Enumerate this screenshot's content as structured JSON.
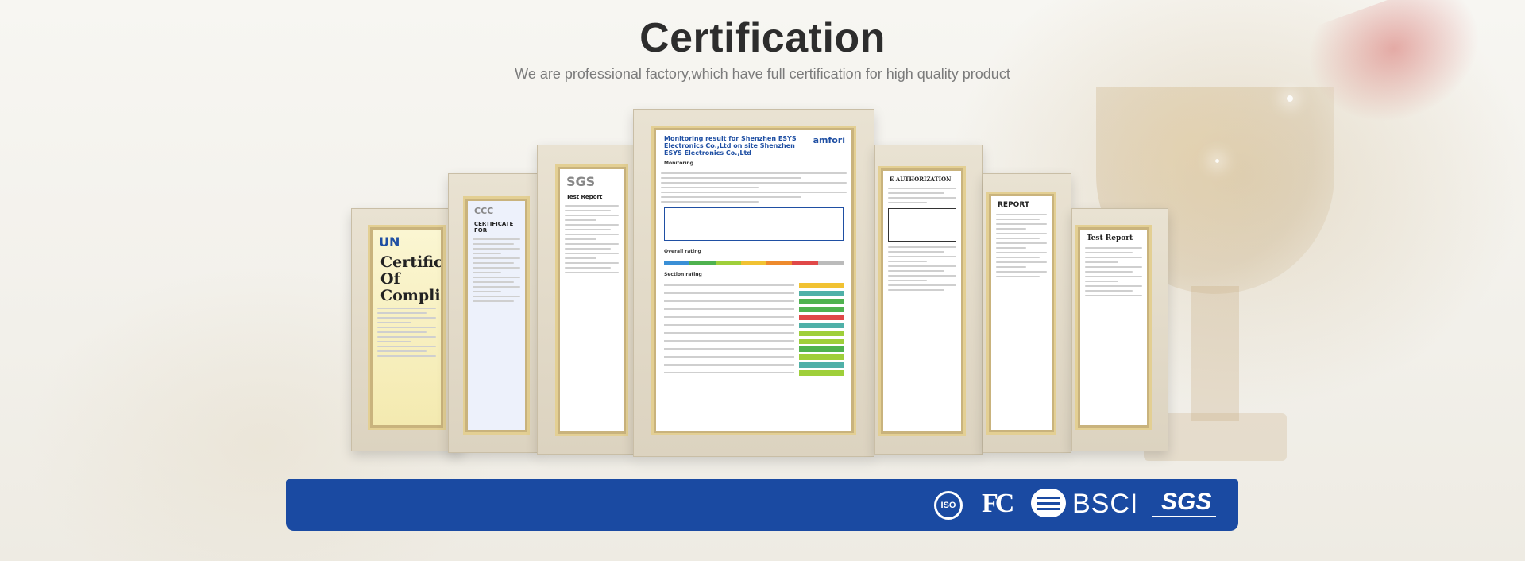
{
  "header": {
    "title": "Certification",
    "subtitle": "We are professional factory,which have full certification for high quality product"
  },
  "certificates": [
    {
      "name": "UN compliance certificate",
      "heading": "Certificate Of Compliance",
      "logo": "UN"
    },
    {
      "name": "CCC certificate",
      "heading": "CERTIFICATE FOR",
      "logo": "CCC"
    },
    {
      "name": "SGS test report",
      "heading": "Test Report",
      "logo": "SGS"
    },
    {
      "name": "amfori monitoring result",
      "heading": "Monitoring result for Shenzhen ESYS Electronics Co.,Ltd on site Shenzhen ESYS Electronics Co.,Ltd",
      "logo": "amfori",
      "section1": "Monitoring",
      "section2": "Overall rating",
      "section3": "Section rating"
    },
    {
      "name": "FCC authorization",
      "heading": "E AUTHORIZATION"
    },
    {
      "name": "test report",
      "heading": "REPORT"
    },
    {
      "name": "test report 2",
      "heading": "Test Report"
    }
  ],
  "banner": {
    "logos": [
      "ISO",
      "FC",
      "BSCI",
      "SGS"
    ],
    "color": "#1a4aa2"
  }
}
